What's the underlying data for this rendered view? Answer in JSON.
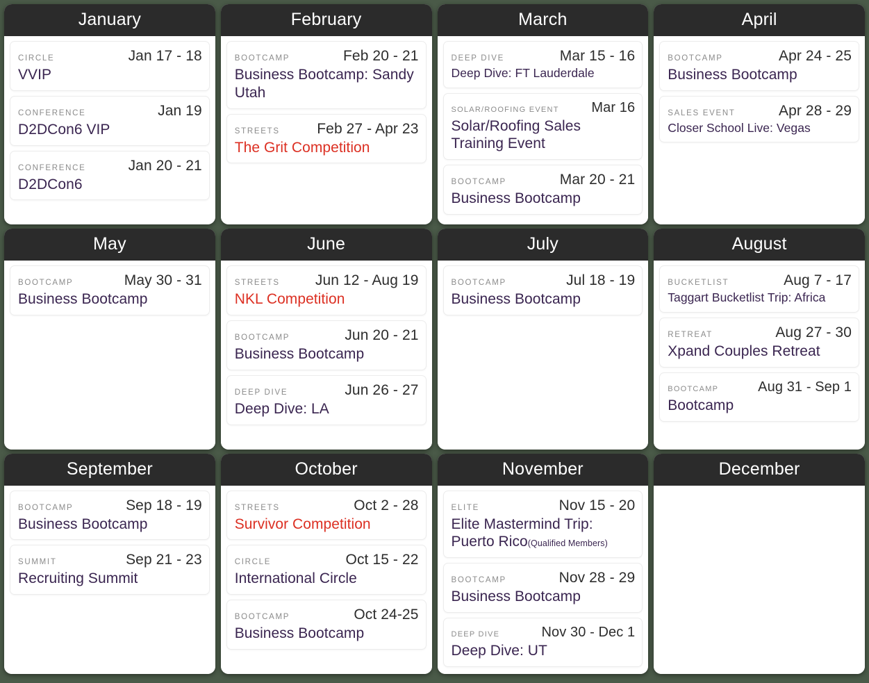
{
  "calendar": {
    "months": [
      {
        "name": "January",
        "events": [
          {
            "category": "CIRCLE",
            "date": "Jan 17 - 18",
            "title": "VVIP",
            "color": "purple"
          },
          {
            "category": "CONFERENCE",
            "date": "Jan 19",
            "title": "D2DCon6 VIP",
            "color": "purple"
          },
          {
            "category": "CONFERENCE",
            "date": "Jan 20 - 21",
            "title": "D2DCon6",
            "color": "purple"
          }
        ]
      },
      {
        "name": "February",
        "events": [
          {
            "category": "BOOTCAMP",
            "date": "Feb 20 - 21",
            "title": "Business Bootcamp: Sandy Utah",
            "color": "purple"
          },
          {
            "category": "STREETS",
            "date": "Feb 27 - Apr 23",
            "title": "The Grit Competition",
            "color": "red"
          }
        ]
      },
      {
        "name": "March",
        "events": [
          {
            "category": "DEEP DIVE",
            "date": "Mar 15 - 16",
            "title": "Deep Dive: FT Lauderdale",
            "color": "purple",
            "size": "small"
          },
          {
            "category": "SOLAR/ROOFING EVENT",
            "date": "Mar 16",
            "title": "Solar/Roofing Sales Training Event",
            "color": "purple",
            "tight": true
          },
          {
            "category": "BOOTCAMP",
            "date": "Mar 20 - 21",
            "title": "Business Bootcamp",
            "color": "purple"
          }
        ]
      },
      {
        "name": "April",
        "events": [
          {
            "category": "BOOTCAMP",
            "date": "Apr 24 - 25",
            "title": "Business Bootcamp",
            "color": "purple"
          },
          {
            "category": "SALES EVENT",
            "date": "Apr 28 - 29",
            "title": "Closer School Live: Vegas",
            "color": "purple",
            "size": "small"
          }
        ]
      },
      {
        "name": "May",
        "events": [
          {
            "category": "BOOTCAMP",
            "date": "May 30 - 31",
            "title": "Business Bootcamp",
            "color": "purple"
          }
        ]
      },
      {
        "name": "June",
        "events": [
          {
            "category": "STREETS",
            "date": "Jun 12 - Aug 19",
            "title": "NKL Competition",
            "color": "red"
          },
          {
            "category": "BOOTCAMP",
            "date": "Jun 20 - 21",
            "title": "Business Bootcamp",
            "color": "purple"
          },
          {
            "category": "DEEP DIVE",
            "date": "Jun 26 - 27",
            "title": "Deep Dive: LA",
            "color": "purple"
          }
        ]
      },
      {
        "name": "July",
        "events": [
          {
            "category": "BOOTCAMP",
            "date": "Jul 18 - 19",
            "title": "Business Bootcamp",
            "color": "purple"
          }
        ]
      },
      {
        "name": "August",
        "events": [
          {
            "category": "BUCKETLIST",
            "date": "Aug 7 - 17",
            "title": "Taggart Bucketlist Trip: Africa",
            "color": "purple",
            "size": "small"
          },
          {
            "category": "RETREAT",
            "date": "Aug 27 - 30",
            "title": "Xpand Couples Retreat",
            "color": "purple"
          },
          {
            "category": "BOOTCAMP",
            "date": "Aug 31 - Sep 1",
            "title": "Bootcamp",
            "color": "purple",
            "tight": true
          }
        ]
      },
      {
        "name": "September",
        "events": [
          {
            "category": "BOOTCAMP",
            "date": "Sep 18 - 19",
            "title": "Business Bootcamp",
            "color": "purple"
          },
          {
            "category": "SUMMIT",
            "date": "Sep 21 - 23",
            "title": "Recruiting Summit",
            "color": "purple"
          }
        ]
      },
      {
        "name": "October",
        "events": [
          {
            "category": "STREETS",
            "date": "Oct 2 - 28",
            "title": "Survivor Competition",
            "color": "red"
          },
          {
            "category": "CIRCLE",
            "date": "Oct 15 - 22",
            "title": "International Circle",
            "color": "purple"
          },
          {
            "category": "BOOTCAMP",
            "date": "Oct 24-25",
            "title": "Business Bootcamp",
            "color": "purple"
          }
        ]
      },
      {
        "name": "November",
        "events": [
          {
            "category": "ELITE",
            "date": "Nov 15 - 20",
            "title": "Elite Mastermind Trip: Puerto Rico",
            "suffix": "(Qualified Members)",
            "color": "purple"
          },
          {
            "category": "BOOTCAMP",
            "date": "Nov 28 - 29",
            "title": "Business Bootcamp",
            "color": "purple"
          },
          {
            "category": "DEEP DIVE",
            "date": "Nov 30 - Dec 1",
            "title": "Deep Dive: UT",
            "color": "purple",
            "tight": true
          }
        ]
      },
      {
        "name": "December",
        "events": []
      }
    ]
  },
  "colors": {
    "page_background": "#4a5a48",
    "month_header_background": "#2b2b2b",
    "month_header_text": "#ffffff",
    "card_background": "#ffffff",
    "category_text": "#8b8b8b",
    "date_text": "#2d2d2d",
    "title_purple": "#3a2550",
    "title_red": "#dc3023"
  }
}
